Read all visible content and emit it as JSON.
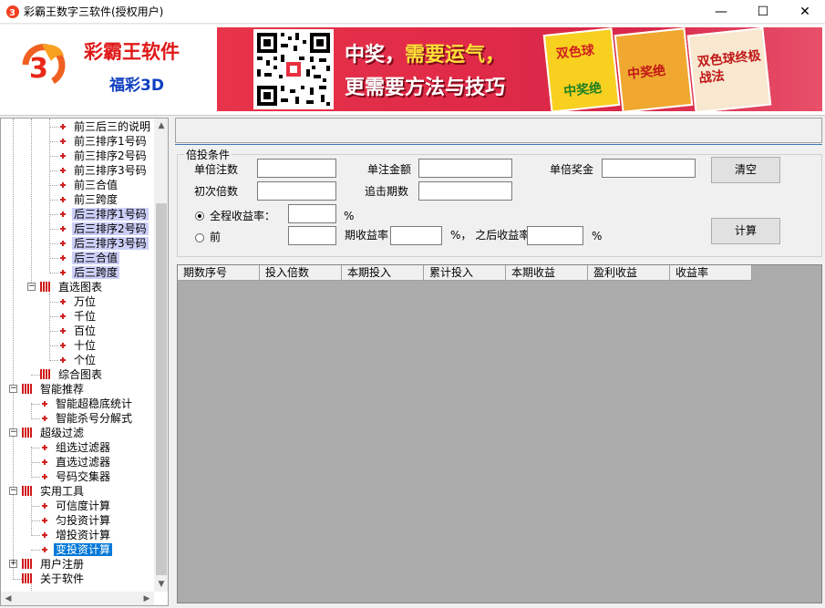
{
  "window": {
    "title": "彩霸王数字三软件(授权用户)",
    "minimize": "—",
    "maximize": "☐",
    "close": "✕"
  },
  "header": {
    "brand_name": "彩霸王软件",
    "brand_sub": "福彩3D",
    "banner": {
      "line1_a": "中奖，",
      "line1_b": "需要运气，",
      "line2": "更需要方法与技巧",
      "book1": "双色球",
      "book2": "中奖绝",
      "book3": "双色球终极战法"
    }
  },
  "tree": {
    "items": [
      {
        "label": "前三后三的说明"
      },
      {
        "label": "前三排序1号码"
      },
      {
        "label": "前三排序2号码"
      },
      {
        "label": "前三排序3号码"
      },
      {
        "label": "前三合值"
      },
      {
        "label": "前三跨度"
      },
      {
        "label": "后三排序1号码"
      },
      {
        "label": "后三排序2号码"
      },
      {
        "label": "后三排序3号码"
      },
      {
        "label": "后三合值"
      },
      {
        "label": "后三跨度"
      },
      {
        "label": "直选图表"
      },
      {
        "label": "万位"
      },
      {
        "label": "千位"
      },
      {
        "label": "百位"
      },
      {
        "label": "十位"
      },
      {
        "label": "个位"
      },
      {
        "label": "综合图表"
      },
      {
        "label": "智能推荐"
      },
      {
        "label": "智能超稳底统计"
      },
      {
        "label": "智能杀号分解式"
      },
      {
        "label": "超级过滤"
      },
      {
        "label": "组选过滤器"
      },
      {
        "label": "直选过滤器"
      },
      {
        "label": "号码交集器"
      },
      {
        "label": "实用工具"
      },
      {
        "label": "可信度计算"
      },
      {
        "label": "匀投资计算"
      },
      {
        "label": "增投资计算"
      },
      {
        "label": "变投资计算"
      },
      {
        "label": "用户注册"
      },
      {
        "label": "关于软件"
      }
    ],
    "expander_minus": "−",
    "expander_plus": "+"
  },
  "form": {
    "legend": "倍投条件",
    "single_bets_label": "单倍注数",
    "single_amount_label": "单注金额",
    "single_prize_label": "单倍奖金",
    "initial_multiple_label": "初次倍数",
    "chase_periods_label": "追击期数",
    "overall_rate_label": "全程收益率：",
    "percent": "%",
    "front_label": "前",
    "period_rate_label": "期收益率",
    "after_rate_label": "%， 之后收益率",
    "clear_button": "清空",
    "calc_button": "计算"
  },
  "grid": {
    "columns": [
      "期数序号",
      "投入倍数",
      "本期投入",
      "累计投入",
      "本期收益",
      "盈利收益",
      "收益率"
    ]
  },
  "scroll": {
    "up": "▲",
    "down": "▼",
    "left": "◀",
    "right": "▶"
  },
  "colors": {
    "accent": "#0078d7",
    "brand_red": "#e01818",
    "brand_blue": "#1040c0"
  }
}
